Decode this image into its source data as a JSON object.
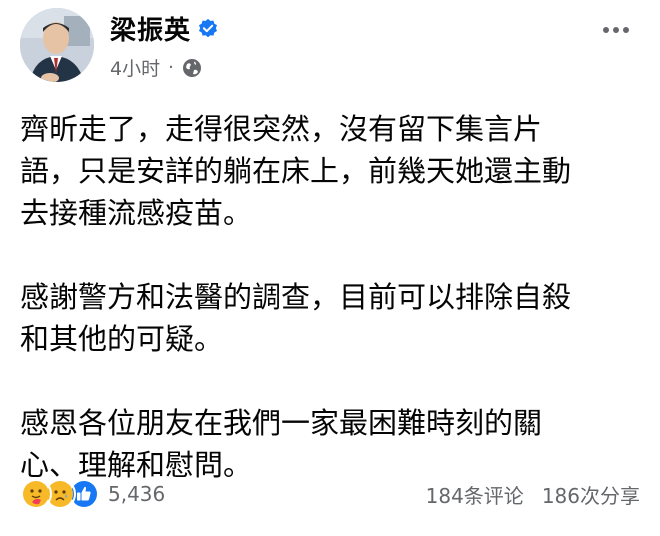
{
  "author": {
    "name": "梁振英",
    "verified": true
  },
  "meta": {
    "time": "4小时",
    "separator": "·",
    "audience_icon": "globe-icon"
  },
  "menu": {
    "icon": "more-horizontal-icon"
  },
  "content": {
    "paragraphs": [
      [
        "齊昕走了，走得很突然，沒有留下集言片",
        "語，只是安詳的躺在床上，前幾天她還主動",
        "去接種流感疫苗。"
      ],
      [
        "感謝警方和法醫的調查，目前可以排除自殺",
        "和其他的可疑。"
      ],
      [
        "感恩各位朋友在我們一家最困難時刻的關",
        "心、理解和慰問。"
      ]
    ]
  },
  "footer": {
    "reaction_icons": [
      "care-reaction-icon",
      "sad-reaction-icon",
      "like-reaction-icon"
    ],
    "reaction_count": "5,436",
    "comments": "184条评论",
    "shares": "186次分享"
  },
  "colors": {
    "verified": "#1877f2",
    "like": "#1877f2",
    "emoji": "#f7b928",
    "meta_text": "#65676b"
  }
}
